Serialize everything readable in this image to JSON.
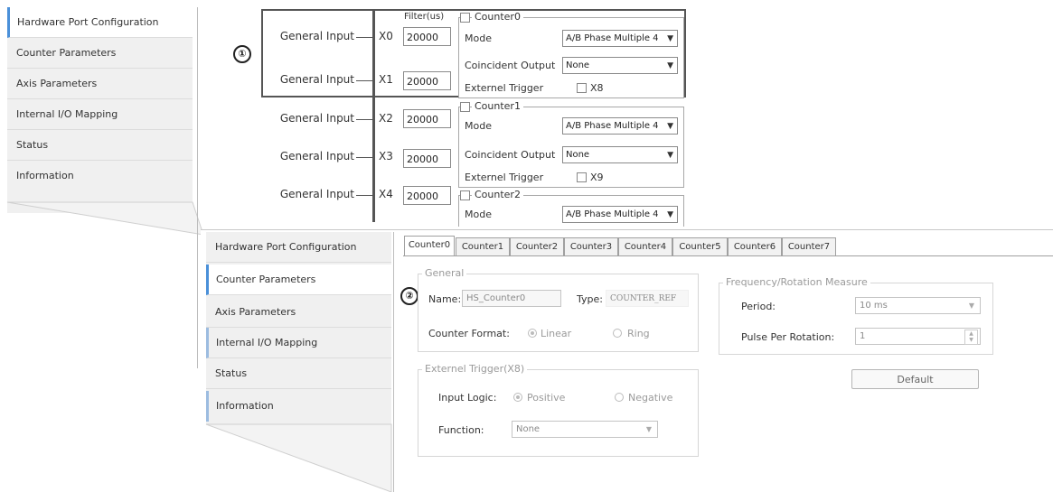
{
  "nav_top": {
    "items": [
      "Hardware Port Configuration",
      "Counter Parameters",
      "Axis Parameters",
      "Internal I/O Mapping",
      "Status",
      "Information"
    ]
  },
  "nav_bottom": {
    "items": [
      "Hardware Port Configuration",
      "Counter Parameters",
      "Axis Parameters",
      "Internal I/O Mapping",
      "Status",
      "Information"
    ]
  },
  "callouts": {
    "one": "①",
    "two": "②"
  },
  "port_config": {
    "filter_header": "Filter(us)",
    "inputs": [
      {
        "label": "General Input",
        "port": "X0",
        "filter": "20000"
      },
      {
        "label": "General Input",
        "port": "X1",
        "filter": "20000"
      },
      {
        "label": "General Input",
        "port": "X2",
        "filter": "20000"
      },
      {
        "label": "General Input",
        "port": "X3",
        "filter": "20000"
      },
      {
        "label": "General Input",
        "port": "X4",
        "filter": "20000"
      }
    ],
    "counters": [
      {
        "name": "Counter0",
        "mode_label": "Mode",
        "mode": "A/B Phase Multiple 4",
        "coincident_label": "Coincident Output",
        "coincident": "None",
        "trigger_label": "Externel Trigger",
        "trigger_port": "X8"
      },
      {
        "name": "Counter1",
        "mode_label": "Mode",
        "mode": "A/B Phase Multiple 4",
        "coincident_label": "Coincident Output",
        "coincident": "None",
        "trigger_label": "Externel Trigger",
        "trigger_port": "X9"
      },
      {
        "name": "Counter2",
        "mode_label": "Mode",
        "mode": "A/B Phase Multiple 4"
      }
    ]
  },
  "counter_tabs": [
    "Counter0",
    "Counter1",
    "Counter2",
    "Counter3",
    "Counter4",
    "Counter5",
    "Counter6",
    "Counter7"
  ],
  "counter_panel": {
    "general": {
      "title": "General",
      "name_label": "Name:",
      "name_value": "HS_Counter0",
      "type_label": "Type:",
      "type_value": "COUNTER_REF",
      "format_label": "Counter Format:",
      "format_options": [
        "Linear",
        "Ring"
      ]
    },
    "trigger": {
      "title": "Externel Trigger(X8)",
      "logic_label": "Input Logic:",
      "logic_options": [
        "Positive",
        "Negative"
      ],
      "function_label": "Function:",
      "function_value": "None"
    },
    "freq": {
      "title": "Frequency/Rotation Measure",
      "period_label": "Period:",
      "period_value": "10 ms",
      "ppr_label": "Pulse Per Rotation:",
      "ppr_value": "1"
    },
    "default_button": "Default"
  }
}
